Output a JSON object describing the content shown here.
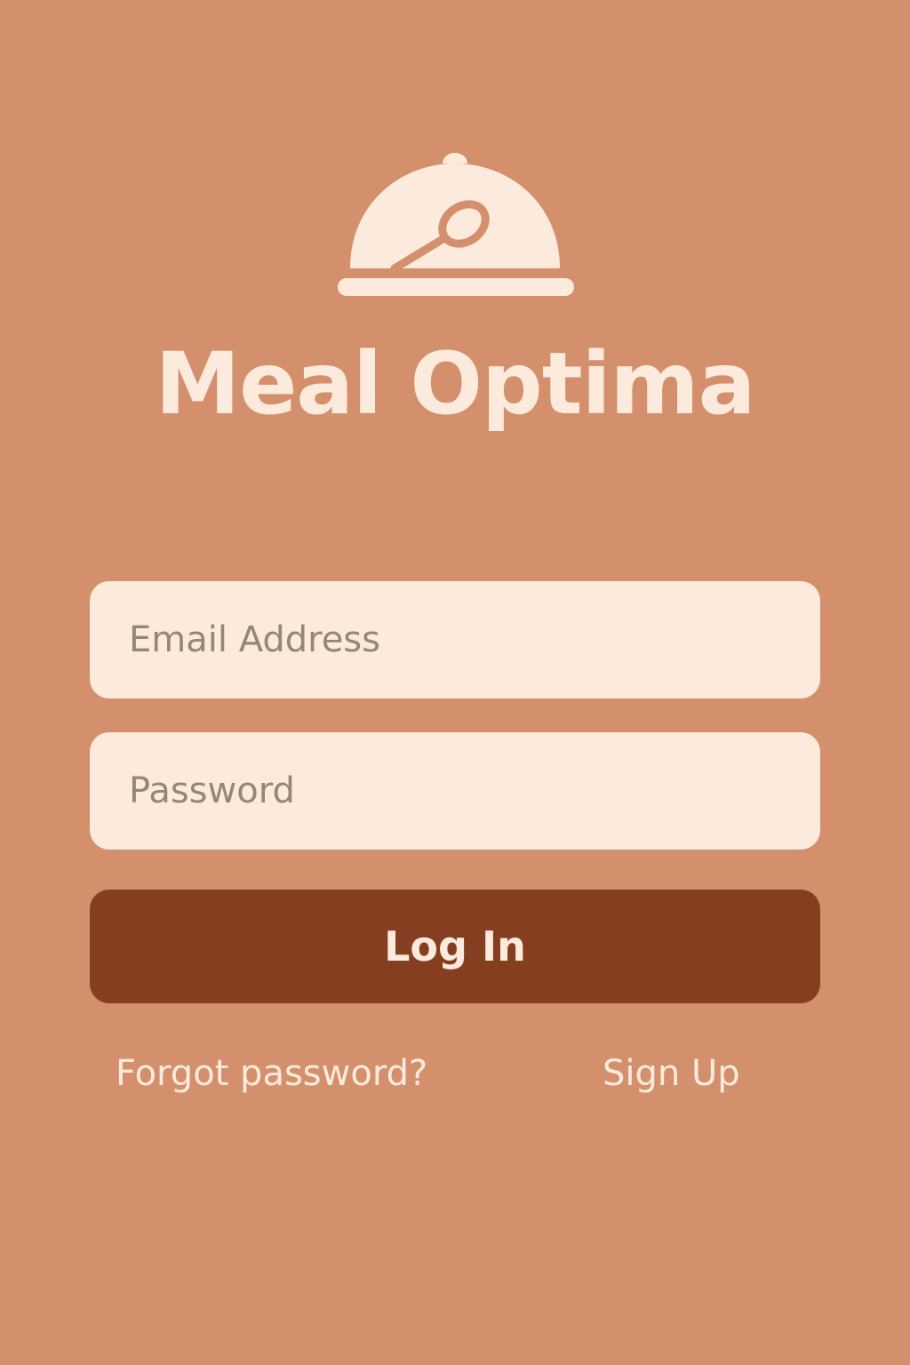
{
  "app": {
    "title": "Meal Optima",
    "logo_icon": "cloche-spoon-icon"
  },
  "form": {
    "email_placeholder": "Email Address",
    "email_value": "",
    "password_placeholder": "Password",
    "password_value": "",
    "login_label": "Log In"
  },
  "links": {
    "forgot_password": "Forgot password?",
    "sign_up": "Sign Up"
  },
  "colors": {
    "background": "#d48f6c",
    "cream": "#fcebdc",
    "accent": "#853f20",
    "placeholder": "#948779"
  }
}
